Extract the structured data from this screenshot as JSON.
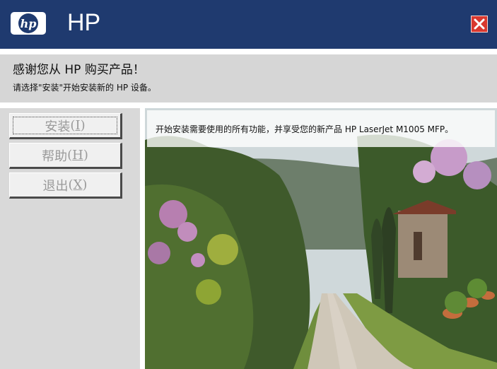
{
  "window": {
    "brand": "HP",
    "logo_text": "hp",
    "close_icon": "close-icon"
  },
  "banner": {
    "title": "感谢您从 HP 购买产品！",
    "subtitle": "请选择\"安装\"开始安装新的 HP 设备。"
  },
  "sidebar": {
    "buttons": [
      {
        "text": "安装",
        "mnemonic": "(I)",
        "mnemonic_key": "I"
      },
      {
        "text": "帮助",
        "mnemonic": "(H)",
        "mnemonic_key": "H"
      },
      {
        "text": "退出",
        "mnemonic": "(X)",
        "mnemonic_key": "X"
      }
    ]
  },
  "main": {
    "caption": "开始安装需要使用的所有功能，并享受您的新产品 HP LaserJet M1005 MFP。",
    "image_icon": "countryside-road-photo"
  },
  "colors": {
    "header_bg": "#1f3a6f",
    "banner_bg": "#d6d6d6",
    "sidebar_bg": "#d9d9d9",
    "close_red": "#d9382f"
  }
}
